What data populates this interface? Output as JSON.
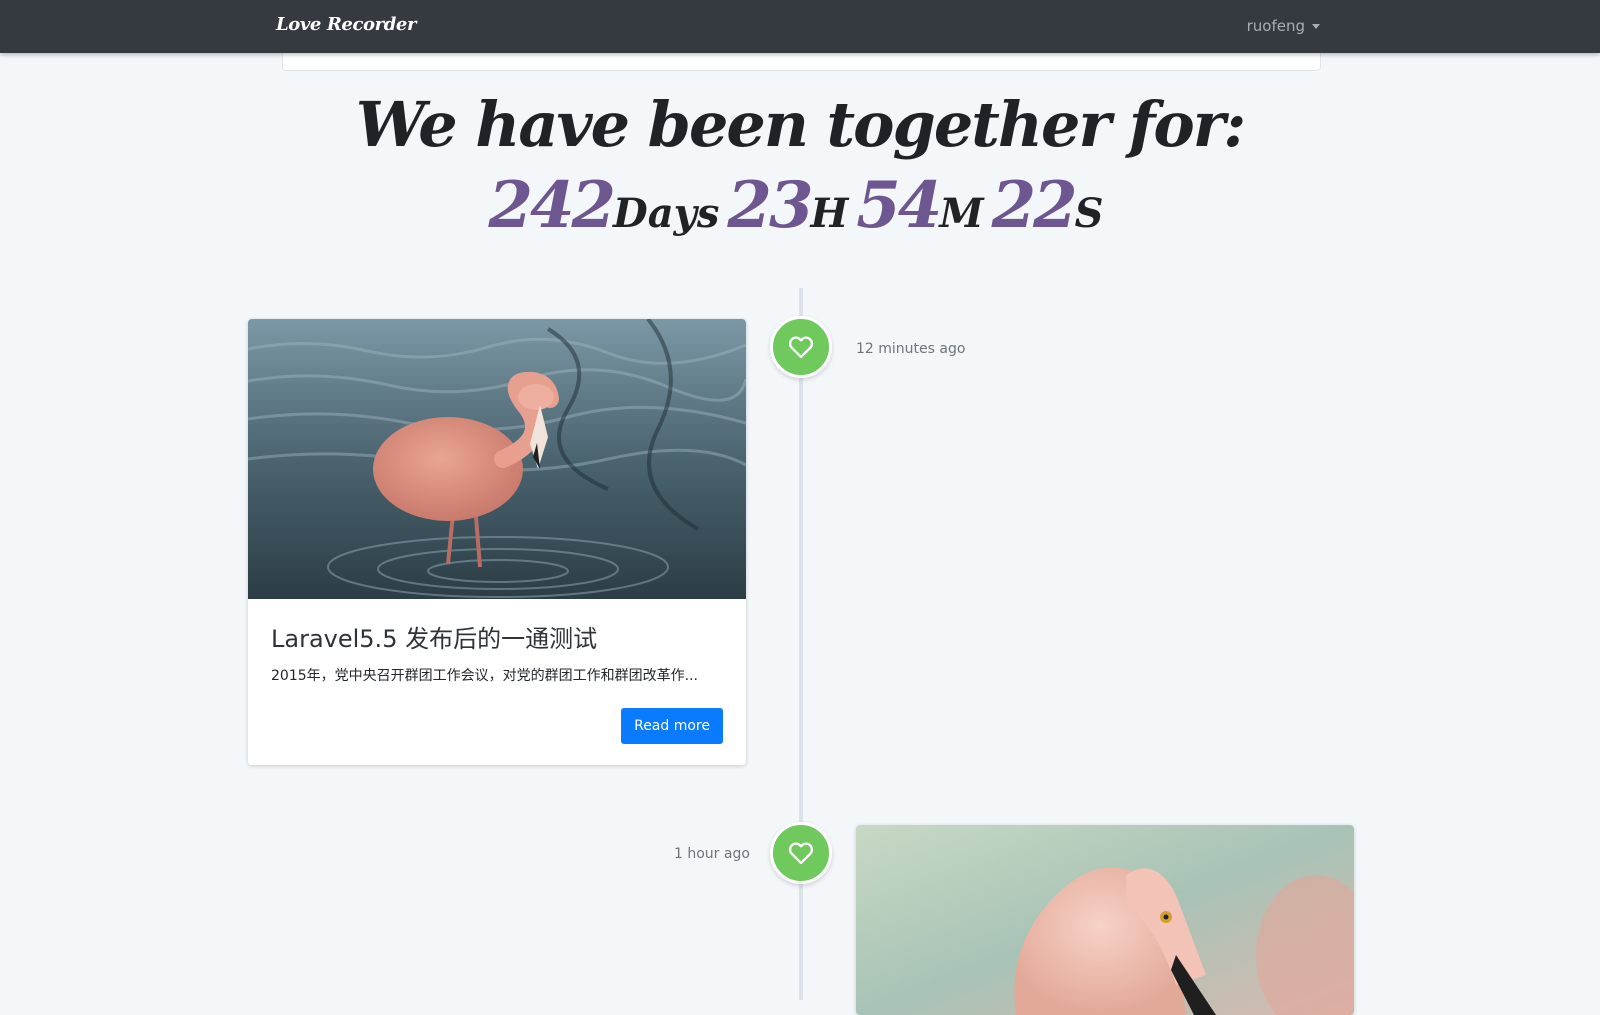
{
  "navbar": {
    "brand": "Love Recorder",
    "user": "ruofeng"
  },
  "hero": {
    "headline": "We have been together for:",
    "counter": {
      "days": "242",
      "days_unit": "Days",
      "hours": "23",
      "hours_unit": "H",
      "minutes": "54",
      "minutes_unit": "M",
      "seconds": "22",
      "seconds_unit": "S"
    }
  },
  "timeline": {
    "entries": [
      {
        "time": "12 minutes ago",
        "title": "Laravel5.5 发布后的一通测试",
        "excerpt": "2015年，党中央召开群团工作会议，对党的群团工作和群团改革作...",
        "button": "Read more"
      },
      {
        "time": "1 hour ago"
      }
    ]
  },
  "colors": {
    "navbar": "#343a40",
    "counter_numbers": "#6e5690",
    "badge": "#6fc95c",
    "primary_button": "#0a7bff"
  },
  "icons": {
    "timeline_badge": "heart-icon",
    "user_menu": "caret-down-icon"
  }
}
